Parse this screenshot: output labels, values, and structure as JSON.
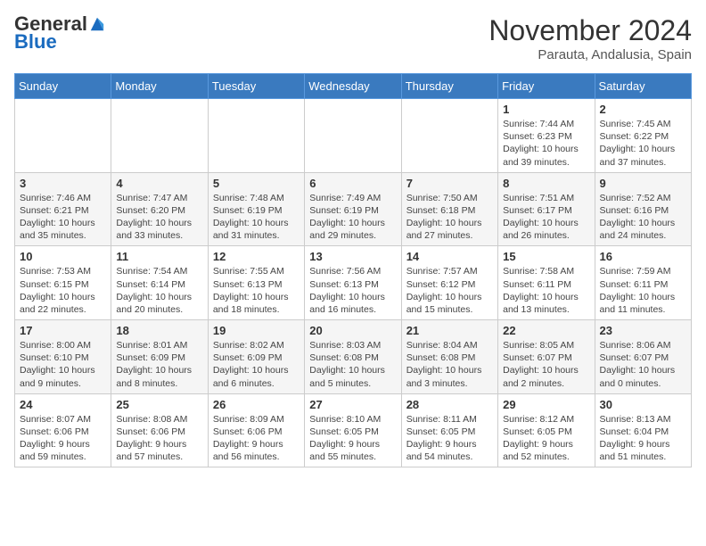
{
  "header": {
    "logo_general": "General",
    "logo_blue": "Blue",
    "month_title": "November 2024",
    "location": "Parauta, Andalusia, Spain"
  },
  "weekdays": [
    "Sunday",
    "Monday",
    "Tuesday",
    "Wednesday",
    "Thursday",
    "Friday",
    "Saturday"
  ],
  "weeks": [
    [
      {
        "day": "",
        "content": ""
      },
      {
        "day": "",
        "content": ""
      },
      {
        "day": "",
        "content": ""
      },
      {
        "day": "",
        "content": ""
      },
      {
        "day": "",
        "content": ""
      },
      {
        "day": "1",
        "content": "Sunrise: 7:44 AM\nSunset: 6:23 PM\nDaylight: 10 hours and 39 minutes."
      },
      {
        "day": "2",
        "content": "Sunrise: 7:45 AM\nSunset: 6:22 PM\nDaylight: 10 hours and 37 minutes."
      }
    ],
    [
      {
        "day": "3",
        "content": "Sunrise: 7:46 AM\nSunset: 6:21 PM\nDaylight: 10 hours and 35 minutes."
      },
      {
        "day": "4",
        "content": "Sunrise: 7:47 AM\nSunset: 6:20 PM\nDaylight: 10 hours and 33 minutes."
      },
      {
        "day": "5",
        "content": "Sunrise: 7:48 AM\nSunset: 6:19 PM\nDaylight: 10 hours and 31 minutes."
      },
      {
        "day": "6",
        "content": "Sunrise: 7:49 AM\nSunset: 6:19 PM\nDaylight: 10 hours and 29 minutes."
      },
      {
        "day": "7",
        "content": "Sunrise: 7:50 AM\nSunset: 6:18 PM\nDaylight: 10 hours and 27 minutes."
      },
      {
        "day": "8",
        "content": "Sunrise: 7:51 AM\nSunset: 6:17 PM\nDaylight: 10 hours and 26 minutes."
      },
      {
        "day": "9",
        "content": "Sunrise: 7:52 AM\nSunset: 6:16 PM\nDaylight: 10 hours and 24 minutes."
      }
    ],
    [
      {
        "day": "10",
        "content": "Sunrise: 7:53 AM\nSunset: 6:15 PM\nDaylight: 10 hours and 22 minutes."
      },
      {
        "day": "11",
        "content": "Sunrise: 7:54 AM\nSunset: 6:14 PM\nDaylight: 10 hours and 20 minutes."
      },
      {
        "day": "12",
        "content": "Sunrise: 7:55 AM\nSunset: 6:13 PM\nDaylight: 10 hours and 18 minutes."
      },
      {
        "day": "13",
        "content": "Sunrise: 7:56 AM\nSunset: 6:13 PM\nDaylight: 10 hours and 16 minutes."
      },
      {
        "day": "14",
        "content": "Sunrise: 7:57 AM\nSunset: 6:12 PM\nDaylight: 10 hours and 15 minutes."
      },
      {
        "day": "15",
        "content": "Sunrise: 7:58 AM\nSunset: 6:11 PM\nDaylight: 10 hours and 13 minutes."
      },
      {
        "day": "16",
        "content": "Sunrise: 7:59 AM\nSunset: 6:11 PM\nDaylight: 10 hours and 11 minutes."
      }
    ],
    [
      {
        "day": "17",
        "content": "Sunrise: 8:00 AM\nSunset: 6:10 PM\nDaylight: 10 hours and 9 minutes."
      },
      {
        "day": "18",
        "content": "Sunrise: 8:01 AM\nSunset: 6:09 PM\nDaylight: 10 hours and 8 minutes."
      },
      {
        "day": "19",
        "content": "Sunrise: 8:02 AM\nSunset: 6:09 PM\nDaylight: 10 hours and 6 minutes."
      },
      {
        "day": "20",
        "content": "Sunrise: 8:03 AM\nSunset: 6:08 PM\nDaylight: 10 hours and 5 minutes."
      },
      {
        "day": "21",
        "content": "Sunrise: 8:04 AM\nSunset: 6:08 PM\nDaylight: 10 hours and 3 minutes."
      },
      {
        "day": "22",
        "content": "Sunrise: 8:05 AM\nSunset: 6:07 PM\nDaylight: 10 hours and 2 minutes."
      },
      {
        "day": "23",
        "content": "Sunrise: 8:06 AM\nSunset: 6:07 PM\nDaylight: 10 hours and 0 minutes."
      }
    ],
    [
      {
        "day": "24",
        "content": "Sunrise: 8:07 AM\nSunset: 6:06 PM\nDaylight: 9 hours and 59 minutes."
      },
      {
        "day": "25",
        "content": "Sunrise: 8:08 AM\nSunset: 6:06 PM\nDaylight: 9 hours and 57 minutes."
      },
      {
        "day": "26",
        "content": "Sunrise: 8:09 AM\nSunset: 6:06 PM\nDaylight: 9 hours and 56 minutes."
      },
      {
        "day": "27",
        "content": "Sunrise: 8:10 AM\nSunset: 6:05 PM\nDaylight: 9 hours and 55 minutes."
      },
      {
        "day": "28",
        "content": "Sunrise: 8:11 AM\nSunset: 6:05 PM\nDaylight: 9 hours and 54 minutes."
      },
      {
        "day": "29",
        "content": "Sunrise: 8:12 AM\nSunset: 6:05 PM\nDaylight: 9 hours and 52 minutes."
      },
      {
        "day": "30",
        "content": "Sunrise: 8:13 AM\nSunset: 6:04 PM\nDaylight: 9 hours and 51 minutes."
      }
    ]
  ]
}
